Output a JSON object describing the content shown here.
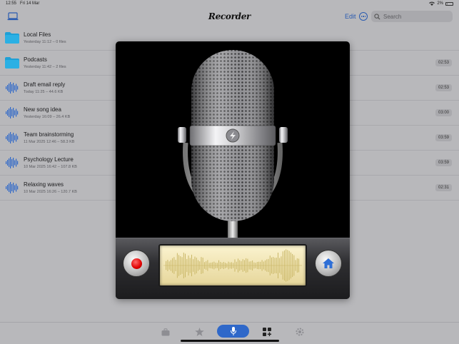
{
  "status_bar": {
    "time": "12:55",
    "date": "Fri 14 Mar",
    "battery": "2%"
  },
  "nav": {
    "title": "Recorder",
    "edit_label": "Edit",
    "search_placeholder": "Search"
  },
  "list": {
    "items": [
      {
        "type": "folder",
        "title": "Local Files",
        "subtitle": "Yesterday 11:12 – 0 files",
        "duration": ""
      },
      {
        "type": "folder",
        "title": "Podcasts",
        "subtitle": "Yesterday 11:42 – 2 files",
        "duration": "02:53"
      },
      {
        "type": "recording",
        "title": "Draft email reply",
        "subtitle": "Today 11:25 – 44.6 KB",
        "duration": "02:53"
      },
      {
        "type": "recording",
        "title": "New song idea",
        "subtitle": "Yesterday 16:09 – 26.4 KB",
        "duration": "03:00"
      },
      {
        "type": "recording",
        "title": "Team brainstorming",
        "subtitle": "11 Mar 2025 12:46 – 58.3 KB",
        "duration": "03:59"
      },
      {
        "type": "recording",
        "title": "Psychology Lecture",
        "subtitle": "10 Mar 2025 16:42 – 107.8 KB",
        "duration": "03:59"
      },
      {
        "type": "recording",
        "title": "Relaxing waves",
        "subtitle": "10 Mar 2025 16:26 – 120.7 KB",
        "duration": "02:31"
      }
    ]
  },
  "colors": {
    "accent": "#2f68c9",
    "folder": "#1ea0d6",
    "record": "#e00000",
    "waveform": "#c7b462"
  },
  "icons": {
    "nav_left": "laptop-icon",
    "folder": "folder-icon",
    "recording": "waveform-icon",
    "record_button": "record-dot-icon",
    "home_button": "home-icon",
    "tabs": [
      "briefcase-icon",
      "star-icon",
      "microphone-icon",
      "apps-plus-icon",
      "gear-icon"
    ]
  },
  "tab_bar": {
    "active": "microphone-icon"
  }
}
